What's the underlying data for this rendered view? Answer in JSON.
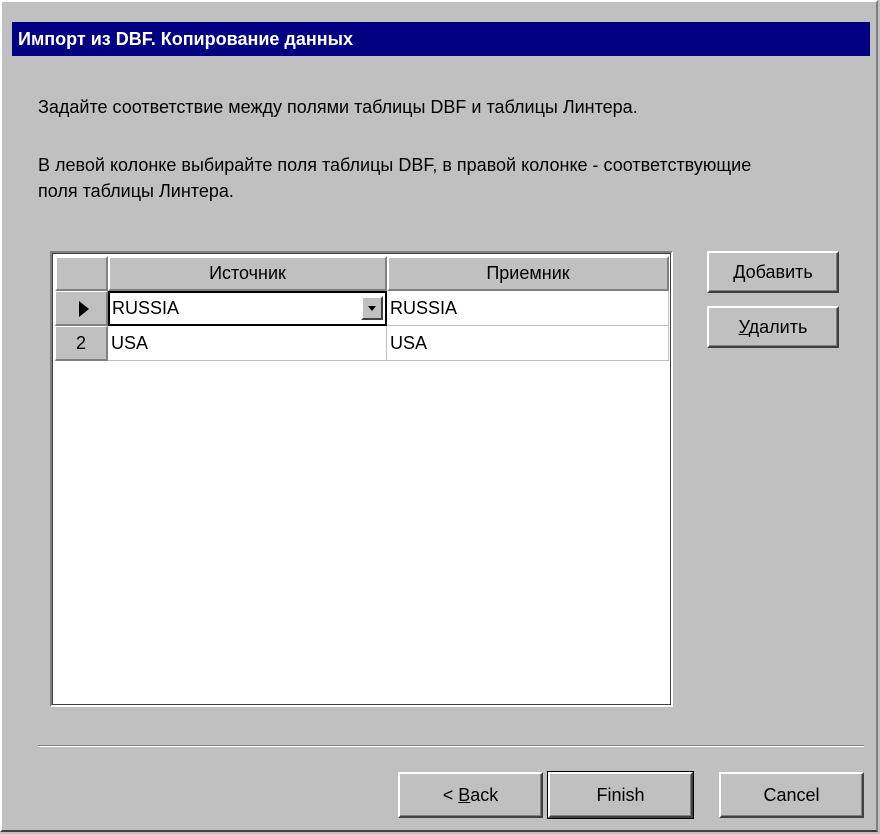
{
  "wizard": {
    "title": "Импорт из DBF. Копирование данных",
    "description_1": "Задайте соответствие между полями таблицы DBF и таблицы Линтера.",
    "description_2": "В левой колонке выбирайте поля таблицы DBF, в правой колонке - соответствующие поля таблицы Линтера."
  },
  "grid": {
    "columns": [
      "Источник",
      "Приемник"
    ],
    "rows": [
      {
        "indicator": "",
        "source": "RUSSIA",
        "target": "RUSSIA"
      },
      {
        "indicator": "2",
        "source": "USA",
        "target": "USA"
      }
    ]
  },
  "side_buttons": {
    "add": {
      "accel": "Д",
      "rest": "обавить"
    },
    "delete": {
      "accel": "У",
      "rest": "далить"
    }
  },
  "footer": {
    "back": {
      "prefix": "< ",
      "accel": "B",
      "rest": "ack"
    },
    "finish": "Finish",
    "cancel": "Cancel"
  },
  "icons": {
    "current_row": "row-pointer-icon",
    "dropdown": "chevron-down-icon"
  }
}
